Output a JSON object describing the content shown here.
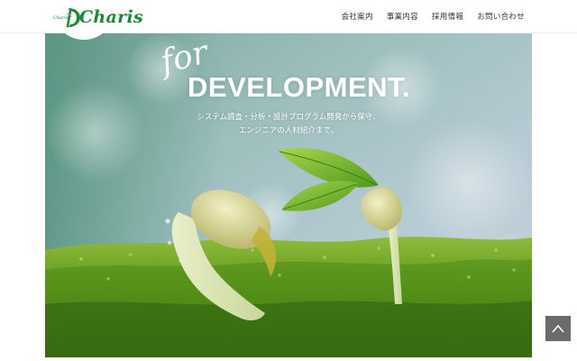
{
  "header": {
    "logo_small": "Charis",
    "logo_text": "Charis",
    "nav": [
      {
        "label": "会社案内"
      },
      {
        "label": "事業内容"
      },
      {
        "label": "採用情報"
      },
      {
        "label": "お問い合わせ"
      }
    ]
  },
  "hero": {
    "script_word": "for",
    "headline": "DEVELOPMENT.",
    "subtitle_line1": "システム調査・分析・設計プログラム開発から保守、",
    "subtitle_line2": "エンジニアの人材紹介まで。"
  },
  "back_to_top": {
    "icon": "chevron-up-icon"
  },
  "colors": {
    "brand": "#1a8a3a",
    "nav_text": "#333333",
    "button_bg": "#6b6b6b"
  }
}
